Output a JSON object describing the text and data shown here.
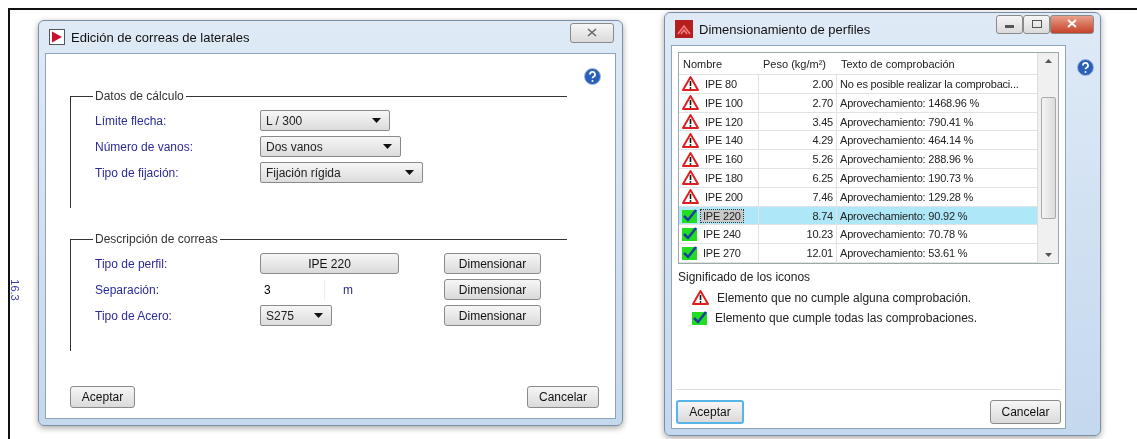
{
  "background": {
    "side_label": "16.3"
  },
  "edit_dialog": {
    "title": "Edición de correas de laterales",
    "groups": [
      {
        "title": "Datos de cálculo",
        "fields": [
          {
            "kind": "combo",
            "label": "Límite flecha:",
            "value": "L / 300"
          },
          {
            "kind": "combo",
            "label": "Número de vanos:",
            "value": "Dos vanos"
          },
          {
            "kind": "combo",
            "label": "Tipo de fijación:",
            "value": "Fijación rígida"
          }
        ]
      },
      {
        "title": "Descripción de correas",
        "fields": [
          {
            "kind": "button",
            "label": "Tipo de perfil:",
            "value": "IPE 220",
            "action": "Dimensionar"
          },
          {
            "kind": "text",
            "label": "Separación:",
            "value": "3",
            "unit": "m",
            "action": "Dimensionar"
          },
          {
            "kind": "combo",
            "label": "Tipo de Acero:",
            "value": "S275",
            "action": "Dimensionar"
          }
        ]
      }
    ],
    "buttons": [
      "Aceptar",
      "Cancelar"
    ]
  },
  "profiles_window": {
    "title": "Dimensionamiento de perfiles",
    "table": {
      "columns": [
        "Nombre",
        "Peso (kg/m²)",
        "Texto de comprobación"
      ],
      "rows": [
        {
          "ok": false,
          "name": "IPE 80",
          "weight": "2.00",
          "text": "No es posible realizar la comprobaci...",
          "selected": false
        },
        {
          "ok": false,
          "name": "IPE 100",
          "weight": "2.70",
          "text": "Aprovechamiento: 1468.96 %",
          "selected": false
        },
        {
          "ok": false,
          "name": "IPE 120",
          "weight": "3.45",
          "text": "Aprovechamiento: 790.41 %",
          "selected": false
        },
        {
          "ok": false,
          "name": "IPE 140",
          "weight": "4.29",
          "text": "Aprovechamiento: 464.14 %",
          "selected": false
        },
        {
          "ok": false,
          "name": "IPE 160",
          "weight": "5.26",
          "text": "Aprovechamiento: 288.96 %",
          "selected": false
        },
        {
          "ok": false,
          "name": "IPE 180",
          "weight": "6.25",
          "text": "Aprovechamiento: 190.73 %",
          "selected": false
        },
        {
          "ok": false,
          "name": "IPE 200",
          "weight": "7.46",
          "text": "Aprovechamiento: 129.28 %",
          "selected": false
        },
        {
          "ok": true,
          "name": "IPE 220",
          "weight": "8.74",
          "text": "Aprovechamiento: 90.92 %",
          "selected": true
        },
        {
          "ok": true,
          "name": "IPE 240",
          "weight": "10.23",
          "text": "Aprovechamiento: 70.78 %",
          "selected": false
        },
        {
          "ok": true,
          "name": "IPE 270",
          "weight": "12.01",
          "text": "Aprovechamiento: 53.61 %",
          "selected": false
        }
      ]
    },
    "legend": {
      "title": "Significado de los iconos",
      "items": [
        {
          "ok": false,
          "text": "Elemento que no cumple alguna comprobación."
        },
        {
          "ok": true,
          "text": "Elemento que cumple todas las comprobaciones."
        }
      ]
    },
    "buttons": [
      "Aceptar",
      "Cancelar"
    ]
  }
}
